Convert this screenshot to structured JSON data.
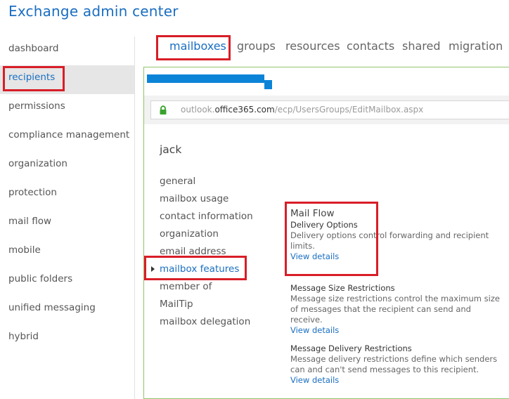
{
  "app_title": "Exchange admin center",
  "left_nav": [
    {
      "label": "dashboard",
      "selected": false
    },
    {
      "label": "recipients",
      "selected": true
    },
    {
      "label": "permissions",
      "selected": false
    },
    {
      "label": "compliance management",
      "selected": false
    },
    {
      "label": "organization",
      "selected": false
    },
    {
      "label": "protection",
      "selected": false
    },
    {
      "label": "mail flow",
      "selected": false
    },
    {
      "label": "mobile",
      "selected": false
    },
    {
      "label": "public folders",
      "selected": false
    },
    {
      "label": "unified messaging",
      "selected": false
    },
    {
      "label": "hybrid",
      "selected": false
    }
  ],
  "tabs": [
    {
      "label": "mailboxes",
      "active": true
    },
    {
      "label": "groups",
      "active": false
    },
    {
      "label": "resources",
      "active": false
    },
    {
      "label": "contacts",
      "active": false
    },
    {
      "label": "shared",
      "active": false
    },
    {
      "label": "migration",
      "active": false
    }
  ],
  "url": {
    "prefix": "outlook.",
    "host": "office365.com",
    "path": "/ecp/UsersGroups/EditMailbox.aspx"
  },
  "user_name": "jack",
  "sub_nav": [
    {
      "label": "general",
      "active": false
    },
    {
      "label": "mailbox usage",
      "active": false
    },
    {
      "label": "contact information",
      "active": false
    },
    {
      "label": "organization",
      "active": false
    },
    {
      "label": "email address",
      "active": false
    },
    {
      "label": "mailbox features",
      "active": true
    },
    {
      "label": "member of",
      "active": false
    },
    {
      "label": "MailTip",
      "active": false
    },
    {
      "label": "mailbox delegation",
      "active": false
    }
  ],
  "details": {
    "section_title": "Mail Flow",
    "items": [
      {
        "heading": "Delivery Options",
        "description_lines": [
          "Delivery options control forwarding and recipient",
          "limits."
        ],
        "link": "View details"
      },
      {
        "heading": "Message Size Restrictions",
        "description_lines": [
          "Message size restrictions control the maximum size",
          "of messages that the recipient can send and receive."
        ],
        "link": "View details"
      },
      {
        "heading": "Message Delivery Restrictions",
        "description_lines": [
          "Message delivery restrictions define which senders",
          "can and can't send messages to this recipient."
        ],
        "link": "View details"
      }
    ]
  },
  "colors": {
    "accent": "#1a6ec1",
    "highlight_box": "#d81e28",
    "title_redaction": "#0b84d8",
    "lock": "#3aa32f"
  },
  "icons": [
    "lock-icon",
    "expand-arrow-icon"
  ]
}
